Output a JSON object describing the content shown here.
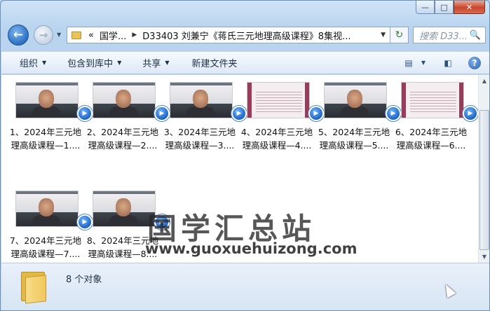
{
  "window": {
    "caption": {
      "minimize": "—",
      "maximize": "□",
      "close": "✕"
    }
  },
  "navbar": {
    "back_icon": "←",
    "forward_icon": "→",
    "address": {
      "overflow": "«",
      "crumbs": [
        "国学...",
        "D33403 刘兼宁《蒋氏三元地理高级课程》8集视..."
      ]
    },
    "refresh_icon": "↻",
    "search_placeholder": "搜索 D33...",
    "search_icon": "🔍"
  },
  "toolbar": {
    "organize": "组织",
    "include_in_library": "包含到库中",
    "share": "共享",
    "new_folder": "新建文件夹"
  },
  "files": [
    {
      "line1": "1、2024年三元地",
      "line2": "理高级课程—1....",
      "thumb": "video"
    },
    {
      "line1": "2、2024年三元地",
      "line2": "理高级课程—2....",
      "thumb": "video"
    },
    {
      "line1": "3、2024年三元地",
      "line2": "理高级课程—3....",
      "thumb": "video"
    },
    {
      "line1": "4、2024年三元地",
      "line2": "理高级课程—4....",
      "thumb": "slide"
    },
    {
      "line1": "5、2024年三元地",
      "line2": "理高级课程—5....",
      "thumb": "video"
    },
    {
      "line1": "6、2024年三元地",
      "line2": "理高级课程—6....",
      "thumb": "slide"
    },
    {
      "line1": "7、2024年三元地",
      "line2": "理高级课程—7....",
      "thumb": "video"
    },
    {
      "line1": "8、2024年三元地",
      "line2": "理高级课程—8....",
      "thumb": "video"
    }
  ],
  "watermark": {
    "text": "国学汇总站",
    "url": "www.guoxuehuizong.com"
  },
  "status": {
    "count": "8 个对象"
  },
  "colors": {
    "accent": "#2c6fc2",
    "close": "#c8462d",
    "folder": "#f0c85e"
  }
}
